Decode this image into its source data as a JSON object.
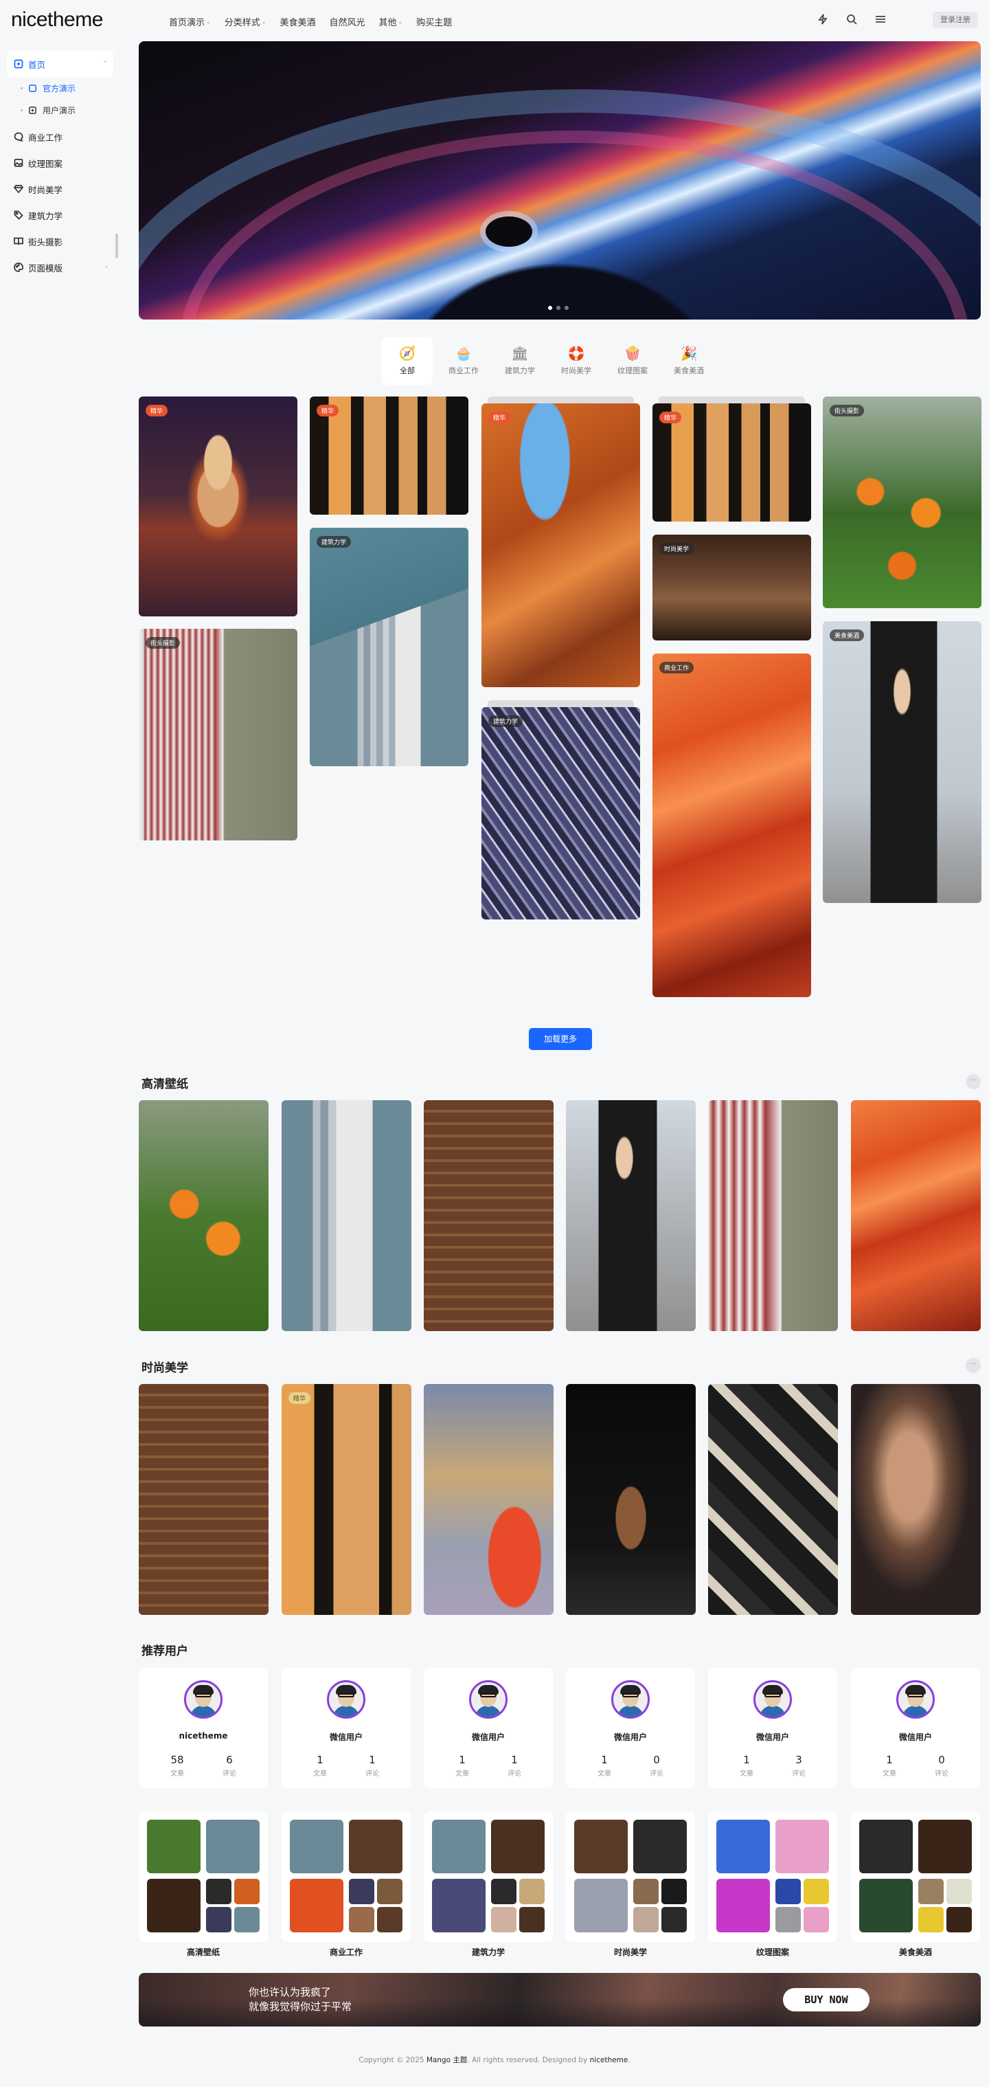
{
  "header": {
    "logo": "nicetheme",
    "nav": [
      "首页演示",
      "分类样式",
      "美食美酒",
      "自然风光",
      "其他",
      "购买主题"
    ],
    "nav_has_caret": [
      true,
      true,
      false,
      false,
      true,
      false
    ],
    "login": "登录注册"
  },
  "sidebar": {
    "items": [
      {
        "label": "首页",
        "icon": "home-icon",
        "active": true
      },
      {
        "label": "官方演示",
        "icon": "box-icon",
        "sub": true,
        "active": true
      },
      {
        "label": "用户演示",
        "icon": "box-icon",
        "sub": true
      },
      {
        "label": "商业工作",
        "icon": "chat-icon"
      },
      {
        "label": "纹理图案",
        "icon": "image-icon"
      },
      {
        "label": "时尚美学",
        "icon": "diamond-icon"
      },
      {
        "label": "建筑力学",
        "icon": "tag-icon"
      },
      {
        "label": "街头摄影",
        "icon": "book-icon"
      },
      {
        "label": "页面模版",
        "icon": "palette-icon"
      }
    ]
  },
  "tabs": [
    {
      "label": "全部",
      "icon": "🧭",
      "active": true
    },
    {
      "label": "商业工作",
      "icon": "🧁"
    },
    {
      "label": "建筑力学",
      "icon": "🏛"
    },
    {
      "label": "时尚美学",
      "icon": "🛟"
    },
    {
      "label": "纹理图案",
      "icon": "🍿"
    },
    {
      "label": "美食美酒",
      "icon": "🎉"
    }
  ],
  "masonry_tags": [
    "精华",
    "精华",
    "精华",
    "精华",
    "街头摄影",
    "街头摄影",
    "建筑力学",
    "建筑力学",
    "时尚美学",
    "商业工作",
    "美食美酒"
  ],
  "load_more": "加载更多",
  "sections": {
    "wallpaper": "高清壁纸",
    "fashion": "时尚美学",
    "users": "推荐用户",
    "more": "···"
  },
  "fashion_tag": "精华",
  "users": [
    {
      "name": "nicetheme",
      "posts": "58",
      "comments": "6"
    },
    {
      "name": "微信用户",
      "posts": "1",
      "comments": "1"
    },
    {
      "name": "微信用户",
      "posts": "1",
      "comments": "1"
    },
    {
      "name": "微信用户",
      "posts": "1",
      "comments": "0"
    },
    {
      "name": "微信用户",
      "posts": "1",
      "comments": "3"
    },
    {
      "name": "微信用户",
      "posts": "1",
      "comments": "0"
    }
  ],
  "user_labels": {
    "posts": "文章",
    "comments": "评论"
  },
  "categories": [
    "高清壁纸",
    "商业工作",
    "建筑力学",
    "时尚美学",
    "纹理图案",
    "美食美酒"
  ],
  "banner": {
    "line1": "你也许认为我疯了",
    "line2": "就像我觉得你过于平常",
    "button": "BUY NOW"
  },
  "footer": {
    "prefix": "Copyright © 2025 ",
    "theme": "Mango 主题",
    "middle": ". All rights reserved. Designed by ",
    "brand": "nicetheme",
    "suffix": "."
  }
}
